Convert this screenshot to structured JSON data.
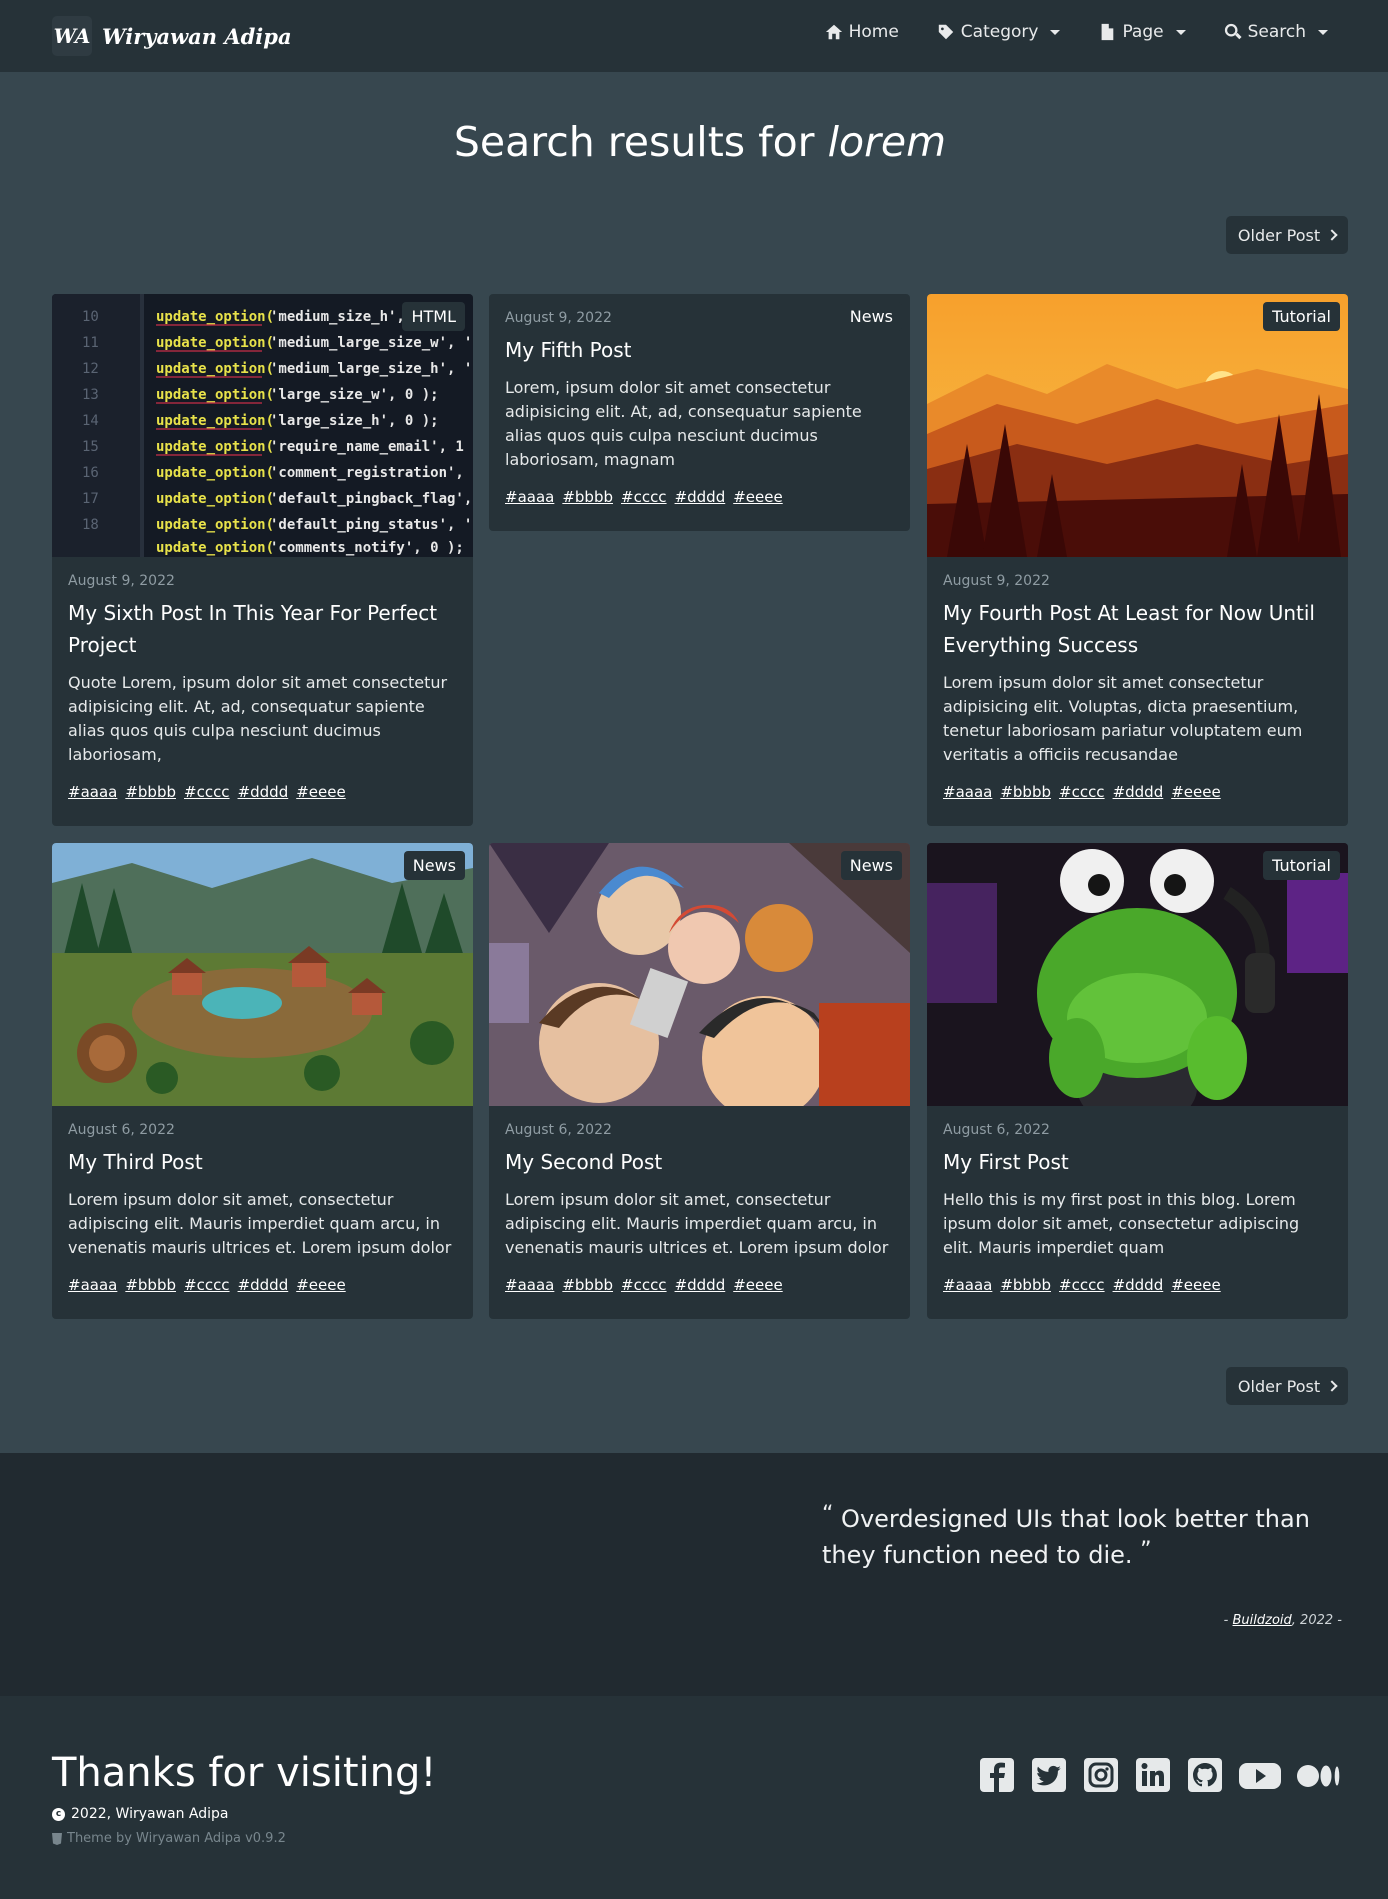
{
  "brand": {
    "logo": "WA",
    "name": "Wiryawan Adipa"
  },
  "nav": {
    "home": "Home",
    "category": "Category",
    "page": "Page",
    "search": "Search"
  },
  "heading": {
    "prefix": "Search results for",
    "query": "lorem"
  },
  "pagination": {
    "older_label": "Older Post"
  },
  "posts": [
    {
      "badge": "HTML",
      "date": "August 9, 2022",
      "title": "My Sixth Post In This Year For Perfect Project",
      "excerpt": "Quote Lorem, ipsum dolor sit amet consectetur adipisicing elit. At, ad, consequatur sapiente alias quos quis culpa nesciunt ducimus laboriosam,",
      "tags": [
        "#aaaa",
        "#bbbb",
        "#cccc",
        "#dddd",
        "#eeee"
      ],
      "image": "code-screenshot"
    },
    {
      "badge": "News",
      "date": "August 9, 2022",
      "title": "My Fifth Post",
      "excerpt": "Lorem, ipsum dolor sit amet consectetur adipisicing elit. At, ad, consequatur sapiente alias quos quis culpa nesciunt ducimus laboriosam, magnam",
      "tags": [
        "#aaaa",
        "#bbbb",
        "#cccc",
        "#dddd",
        "#eeee"
      ],
      "image": ""
    },
    {
      "badge": "Tutorial",
      "date": "August 9, 2022",
      "title": "My Fourth Post At Least for Now Until Everything Success",
      "excerpt": "Lorem ipsum dolor sit amet consectetur adipisicing elit. Voluptas, dicta praesentium, tenetur laboriosam pariatur voluptatem eum veritatis a officiis recusandae",
      "tags": [
        "#aaaa",
        "#bbbb",
        "#cccc",
        "#dddd",
        "#eeee"
      ],
      "image": "sunset-forest"
    },
    {
      "badge": "News",
      "date": "August 6, 2022",
      "title": "My Third Post",
      "excerpt": "Lorem ipsum dolor sit amet, consectetur adipiscing elit. Mauris imperdiet quam arcu, in venenatis mauris ultrices et. Lorem ipsum dolor",
      "tags": [
        "#aaaa",
        "#bbbb",
        "#cccc",
        "#dddd",
        "#eeee"
      ],
      "image": "fantasy-village"
    },
    {
      "badge": "News",
      "date": "August 6, 2022",
      "title": "My Second Post",
      "excerpt": "Lorem ipsum dolor sit amet, consectetur adipiscing elit. Mauris imperdiet quam arcu, in venenatis mauris ultrices et. Lorem ipsum dolor",
      "tags": [
        "#aaaa",
        "#bbbb",
        "#cccc",
        "#dddd",
        "#eeee"
      ],
      "image": "anime-collage"
    },
    {
      "badge": "Tutorial",
      "date": "August 6, 2022",
      "title": "My First Post",
      "excerpt": "Hello this is my first post in this blog. Lorem ipsum dolor sit amet, consectetur adipiscing elit. Mauris imperdiet quam",
      "tags": [
        "#aaaa",
        "#bbbb",
        "#cccc",
        "#dddd",
        "#eeee"
      ],
      "image": "green-plush"
    }
  ],
  "quote": {
    "open": "“",
    "text": "Overdesigned UIs that look better than they function need to die.",
    "close": "”",
    "dash": "-",
    "author": "Buildzoid",
    "year": ", 2022"
  },
  "footer": {
    "title": "Thanks for visiting!",
    "copyright": "2022, Wiryawan Adipa",
    "theme": "Theme by Wiryawan Adipa v0.9.2",
    "socials": [
      "facebook-icon",
      "twitter-icon",
      "instagram-icon",
      "linkedin-icon",
      "github-icon",
      "youtube-icon",
      "medium-icon"
    ]
  },
  "colors": {
    "background": "#37474f",
    "navbar": "#263238",
    "quote_bg": "#212a30"
  }
}
